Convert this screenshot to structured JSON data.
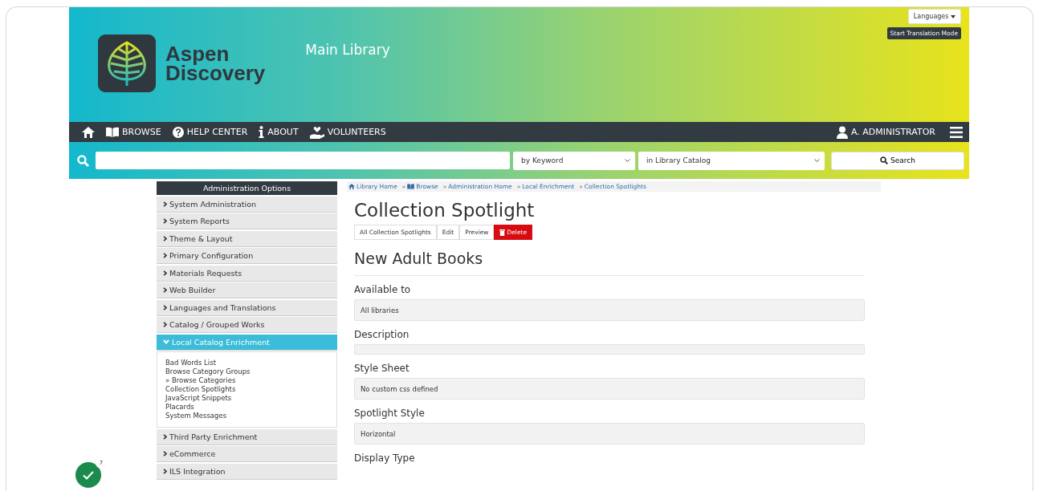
{
  "header": {
    "logo_line1": "Aspen",
    "logo_line2": "Discovery",
    "library": "Main Library",
    "languages_button": "Languages",
    "translation_button": "Start Translation Mode"
  },
  "nav": {
    "items": [
      {
        "kind": "home"
      },
      {
        "kind": "book",
        "label": "BROWSE"
      },
      {
        "kind": "help",
        "label": "HELP CENTER"
      },
      {
        "kind": "info",
        "label": "ABOUT"
      },
      {
        "kind": "hand",
        "label": "VOLUNTEERS"
      }
    ],
    "user": "A. ADMINISTRATOR"
  },
  "search": {
    "type": "by Keyword",
    "scope": "in Library Catalog",
    "button": "Search"
  },
  "sidebar": {
    "title": "Administration Options",
    "sections": [
      {
        "label": "System Administration",
        "expanded": false
      },
      {
        "label": "System Reports",
        "expanded": false
      },
      {
        "label": "Theme & Layout",
        "expanded": false
      },
      {
        "label": "Primary Configuration",
        "expanded": false
      },
      {
        "label": "Materials Requests",
        "expanded": false
      },
      {
        "label": "Web Builder",
        "expanded": false
      },
      {
        "label": "Languages and Translations",
        "expanded": false
      },
      {
        "label": "Catalog / Grouped Works",
        "expanded": false
      },
      {
        "label": "Local Catalog Enrichment",
        "expanded": true,
        "children": [
          {
            "label": "Bad Words List"
          },
          {
            "label": "Browse Category Groups"
          },
          {
            "label": "» Browse Categories"
          },
          {
            "label": "Collection Spotlights"
          },
          {
            "label": "JavaScript Snippets"
          },
          {
            "label": "Placards"
          },
          {
            "label": "System Messages"
          }
        ]
      },
      {
        "label": "Third Party Enrichment",
        "expanded": false
      },
      {
        "label": "eCommerce",
        "expanded": false
      },
      {
        "label": "ILS Integration",
        "expanded": false
      }
    ]
  },
  "breadcrumb_separator": "»",
  "breadcrumbs": [
    {
      "kind": "home",
      "label": "Library Home"
    },
    {
      "kind": "book",
      "label": "Browse"
    },
    {
      "kind": "plain",
      "label": "Administration Home"
    },
    {
      "kind": "plain",
      "label": "Local Enrichment"
    },
    {
      "kind": "plain",
      "label": "Collection Spotlights"
    }
  ],
  "page_title": "Collection Spotlight",
  "actions": [
    {
      "kind": "normal",
      "label": "All Collection Spotlights"
    },
    {
      "kind": "normal",
      "label": "Edit"
    },
    {
      "kind": "normal",
      "label": "Preview"
    },
    {
      "kind": "danger",
      "label": "Delete"
    }
  ],
  "record_title": "New Adult Books",
  "fields": [
    {
      "kind": "text",
      "label": "Available to",
      "value": "All libraries"
    },
    {
      "kind": "empty",
      "label": "Description"
    },
    {
      "kind": "text",
      "label": "Style Sheet",
      "value": "No custom css defined"
    },
    {
      "kind": "text",
      "label": "Spotlight Style",
      "value": "Horizontal"
    },
    {
      "kind": "label",
      "label": "Display Type"
    }
  ],
  "badge": {
    "count": "7"
  }
}
